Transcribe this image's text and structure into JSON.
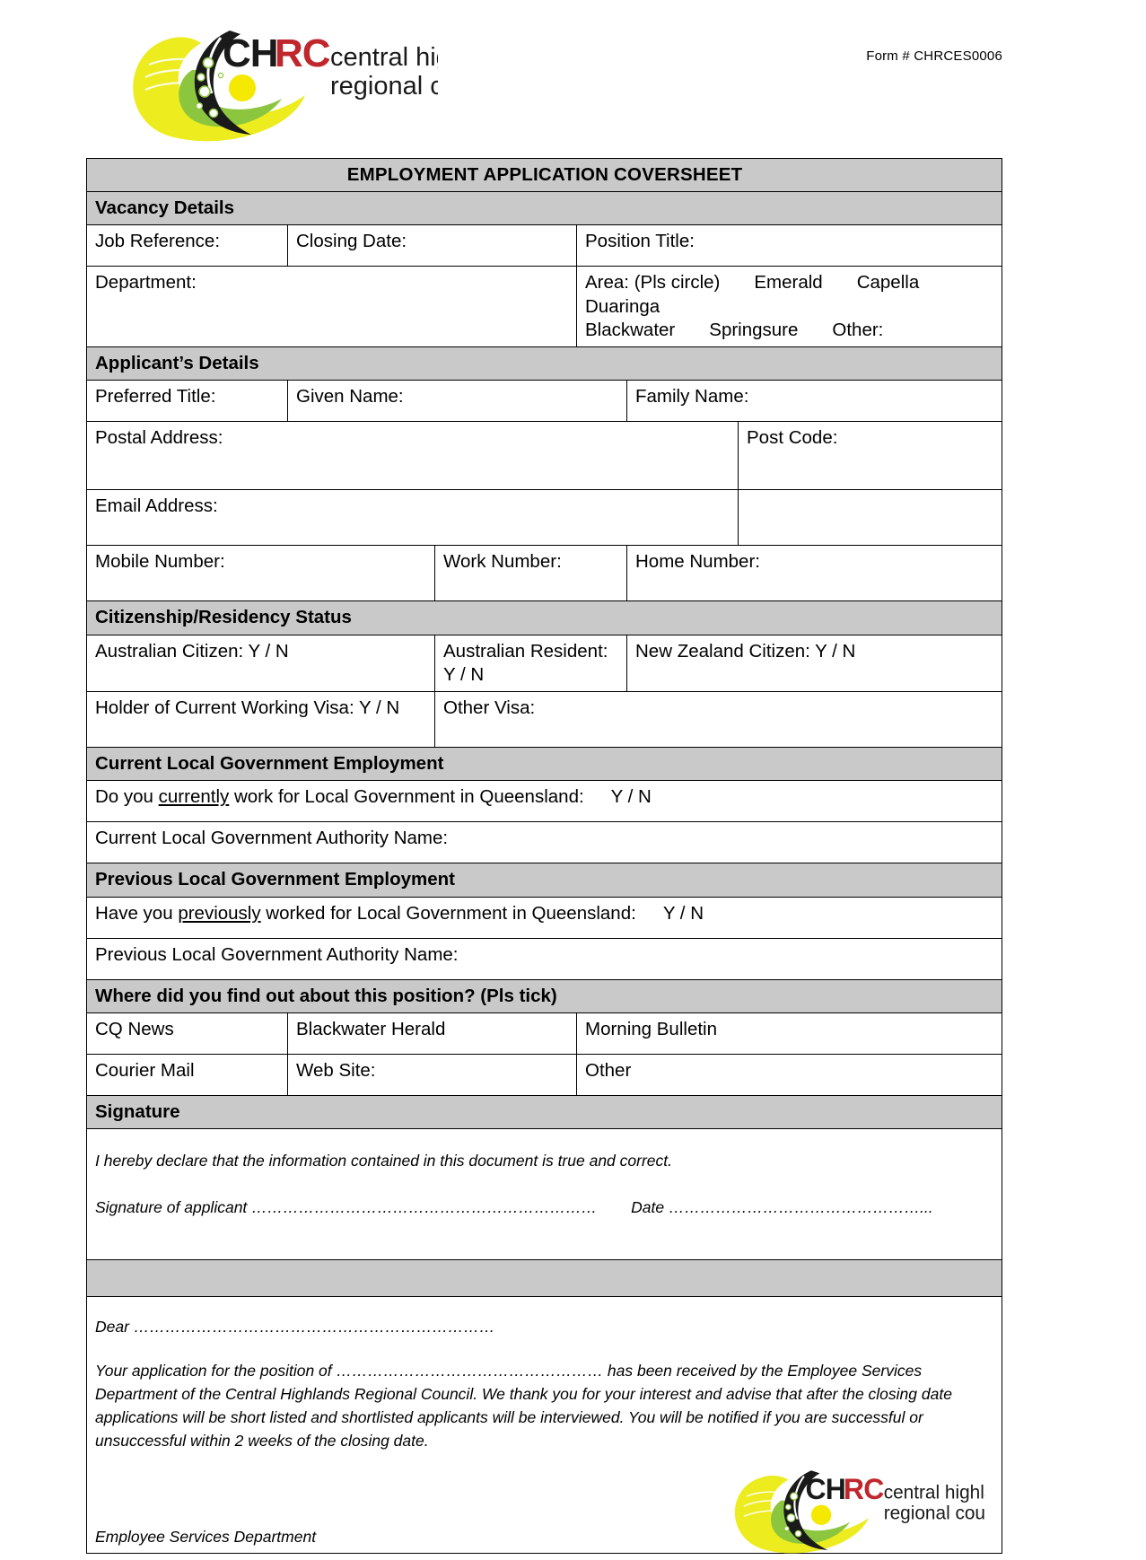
{
  "header": {
    "form_number": "Form # CHRCES0006",
    "logo": {
      "mark_text": "CHRC",
      "line1": "central highlands",
      "line2": "regional council",
      "colors": {
        "yellow": "#ecec1e",
        "green": "#8cc63f",
        "dark": "#1a1a1a",
        "red": "#c0272d",
        "dot_yellow": "#f5e900"
      }
    }
  },
  "form": {
    "title": "EMPLOYMENT APPLICATION COVERSHEET",
    "sections": {
      "vacancy_details": "Vacancy Details",
      "applicants_details": "Applicant’s Details",
      "citizenship": "Citizenship/Residency Status",
      "current_lg": "Current Local Government Employment",
      "previous_lg": "Previous Local Government Employment",
      "find_out": "Where did you find out about this position? (Pls tick)",
      "signature": "Signature"
    },
    "fields": {
      "job_reference": "Job Reference:",
      "closing_date": "Closing Date:",
      "position_title": "Position Title:",
      "department": "Department:",
      "area_label": "Area: (Pls circle)",
      "area_options_row1": [
        "Emerald",
        "Capella",
        "Duaringa"
      ],
      "area_options_row2": [
        "Blackwater",
        "Springsure"
      ],
      "area_other": "Other:",
      "preferred_title": "Preferred Title:",
      "given_name": "Given Name:",
      "family_name": "Family Name:",
      "postal_address": "Postal Address:",
      "post_code": "Post Code:",
      "email_address": "Email Address:",
      "mobile_number": "Mobile Number:",
      "work_number": "Work Number:",
      "home_number": "Home Number:",
      "australian_citizen": "Australian Citizen:  Y / N",
      "australian_resident": "Australian Resident:   Y / N",
      "new_zealand_citizen": "New Zealand Citizen:  Y / N",
      "working_visa": "Holder of Current Working Visa: Y / N",
      "other_visa": "Other Visa:",
      "current_q_pre": "Do you ",
      "current_q_underline": "currently",
      "current_q_post": " work for Local Government in Queensland:",
      "current_q_yn": "Y /  N",
      "current_authority": "Current Local Government Authority Name:",
      "previous_q_pre": "Have you ",
      "previous_q_underline": "previously",
      "previous_q_post": " worked for Local Government in Queensland:",
      "previous_q_yn": "Y /  N",
      "previous_authority": "Previous Local Government Authority Name:"
    },
    "find_out_options": [
      [
        "CQ News",
        "Blackwater Herald",
        "Morning Bulletin"
      ],
      [
        "Courier Mail",
        "Web Site:",
        "Other"
      ]
    ],
    "signature_block": {
      "declaration": "I hereby declare that the information contained in this document is true and correct.",
      "signature_label": "Signature of applicant",
      "signature_dots": "…………………………………………………………",
      "date_label": "Date",
      "date_dots": "…………………………………………..."
    },
    "letter": {
      "dear_label": "Dear",
      "dear_dots": "……………………………………………………………",
      "paragraph_pre": "Your application for the position of ",
      "paragraph_dots": "……………………………………………",
      "paragraph_post": " has been received by the Employee Services Department of the Central Highlands Regional Council. We thank you for your interest and advise that after the closing date applications will be short listed and shortlisted applicants will be interviewed. You will be notified if you are successful or unsuccessful within 2 weeks of the closing date.",
      "footer": "Employee Services Department"
    }
  }
}
